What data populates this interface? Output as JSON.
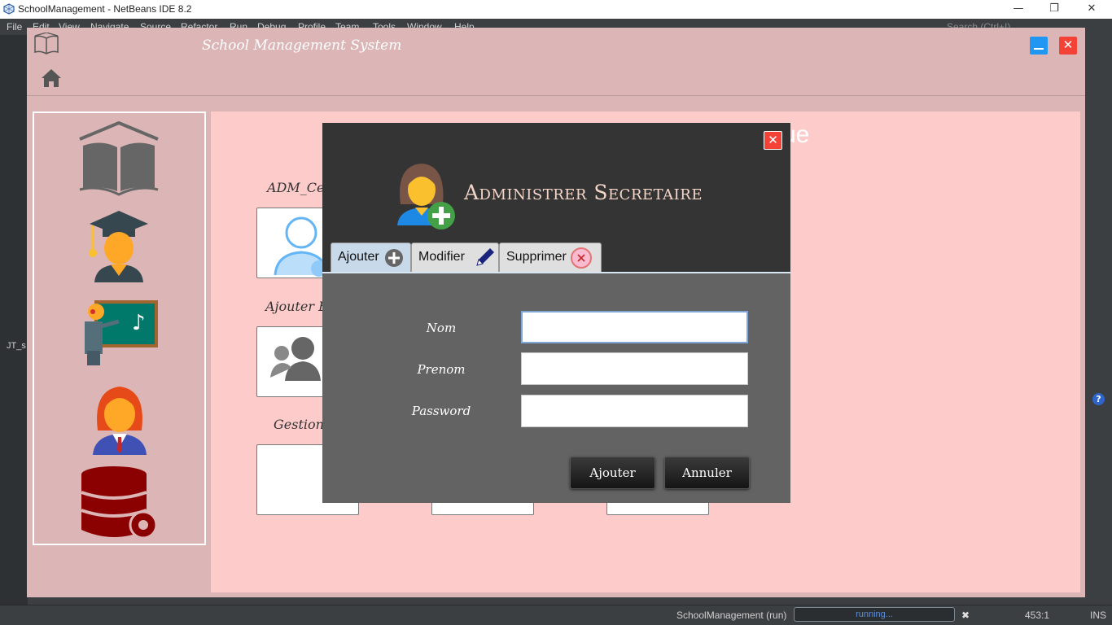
{
  "ide": {
    "window_title": "SchoolManagement - NetBeans IDE 8.2",
    "menu": [
      "File",
      "Edit",
      "View",
      "Navigate",
      "Source",
      "Refactor",
      "Run",
      "Debug",
      "Profile",
      "Team",
      "Tools",
      "Window",
      "Help"
    ],
    "search_placeholder": "Search (Ctrl+I)",
    "panel_label": "JT_s",
    "status": {
      "project": "SchoolManagement (run)",
      "progress_text": "running...",
      "position": "453:1",
      "mode": "INS"
    }
  },
  "app": {
    "title": "School Management System",
    "background_cards": {
      "labels": [
        "ADM_Ce",
        "Ajouter Emp",
        "Gestion E"
      ],
      "title_tail": "ue"
    }
  },
  "dialog": {
    "title": "Administrer Secretaire",
    "tabs": [
      {
        "label": "Ajouter",
        "icon": "plus-circle-icon",
        "active": true
      },
      {
        "label": "Modifier",
        "icon": "pencil-icon",
        "active": false
      },
      {
        "label": "Supprimer",
        "icon": "remove-circle-icon",
        "active": false
      }
    ],
    "fields": [
      {
        "label": "Nom",
        "value": ""
      },
      {
        "label": "Prenom",
        "value": ""
      },
      {
        "label": "Password",
        "value": ""
      }
    ],
    "buttons": {
      "submit": "Ajouter",
      "cancel": "Annuler"
    }
  },
  "colors": {
    "app_bg": "#dcb6b6",
    "main_bg": "#fecbcb",
    "dialog_head": "#343434",
    "dialog_body": "#636363",
    "close_red": "#f44336",
    "minimize_blue": "#2196f3"
  }
}
